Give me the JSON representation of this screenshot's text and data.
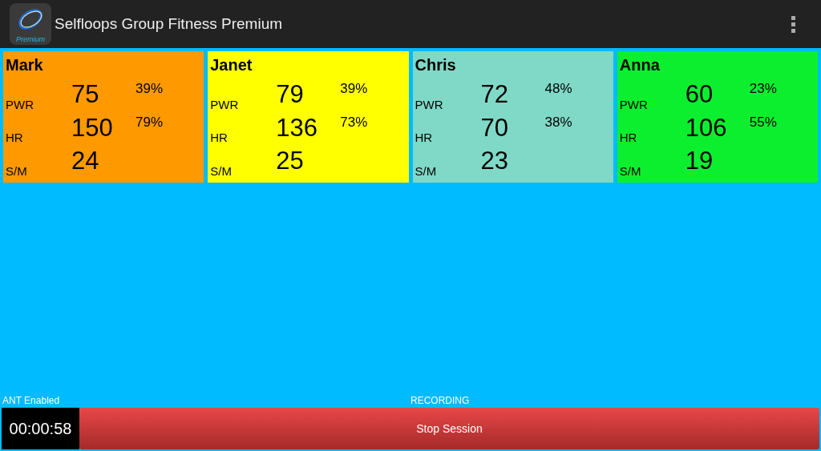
{
  "app_bar": {
    "title": "Selfloops Group Fitness Premium",
    "logo_text": "Premium"
  },
  "athletes": [
    {
      "name": "Mark",
      "color": "#ff9900",
      "metrics": [
        {
          "label": "PWR",
          "value": "75",
          "percent": "39%"
        },
        {
          "label": "HR",
          "value": "150",
          "percent": "79%"
        },
        {
          "label": "S/M",
          "value": "24"
        }
      ]
    },
    {
      "name": "Janet",
      "color": "#ffff00",
      "metrics": [
        {
          "label": "PWR",
          "value": "79",
          "percent": "39%"
        },
        {
          "label": "HR",
          "value": "136",
          "percent": "73%"
        },
        {
          "label": "S/M",
          "value": "25"
        }
      ]
    },
    {
      "name": "Chris",
      "color": "#7fd9c6",
      "metrics": [
        {
          "label": "PWR",
          "value": "72",
          "percent": "48%"
        },
        {
          "label": "HR",
          "value": "70",
          "percent": "38%"
        },
        {
          "label": "S/M",
          "value": "23"
        }
      ]
    },
    {
      "name": "Anna",
      "color": "#0cef2f",
      "metrics": [
        {
          "label": "PWR",
          "value": "60",
          "percent": "23%"
        },
        {
          "label": "HR",
          "value": "106",
          "percent": "55%"
        },
        {
          "label": "S/M",
          "value": "19"
        }
      ]
    }
  ],
  "status": {
    "ant": "ANT Enabled",
    "recording": "RECORDING"
  },
  "timer": "00:00:58",
  "stop_button": "Stop Session"
}
